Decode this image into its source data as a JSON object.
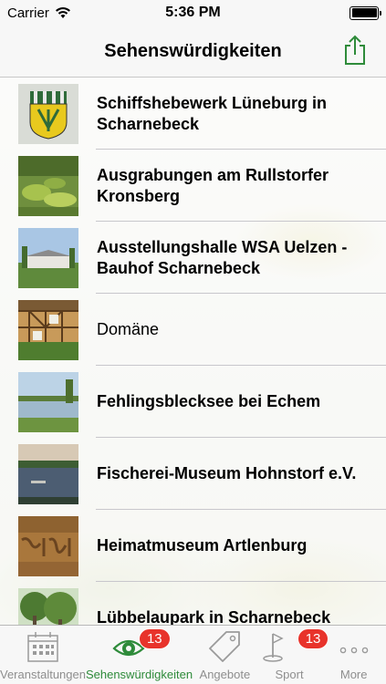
{
  "status": {
    "carrier": "Carrier",
    "time": "5:36 PM",
    "battery_level": 1.0
  },
  "nav": {
    "title": "Sehenswürdigkeiten"
  },
  "items": [
    {
      "label": "Schiffshebewerk  Lüneburg in Scharnebeck",
      "thumb": "coat-of-arms"
    },
    {
      "label": "Ausgrabungen am Rullstorfer Kronsberg",
      "thumb": "garden"
    },
    {
      "label": "Ausstellungshalle WSA Uelzen - Bauhof Scharnebeck",
      "thumb": "hall"
    },
    {
      "label": "Domäne",
      "thumb": "half-timbered-house"
    },
    {
      "label": "Fehlingsblecksee bei Echem",
      "thumb": "lake"
    },
    {
      "label": "Fischerei-Museum Hohnstorf e.V.",
      "thumb": "river"
    },
    {
      "label": "Heimatmuseum Artlenburg",
      "thumb": "inscription"
    },
    {
      "label": "Lübbelaupark in Scharnebeck",
      "thumb": "park"
    }
  ],
  "tabs": [
    {
      "label": "Veranstaltungen",
      "icon": "calendar-icon"
    },
    {
      "label": "Sehenswürdigkeiten",
      "icon": "eye-icon",
      "badge": "13"
    },
    {
      "label": "Angebote",
      "icon": "tag-icon"
    },
    {
      "label": "Sport",
      "icon": "golf-icon",
      "badge": "13"
    },
    {
      "label": "More",
      "icon": "more-icon"
    }
  ],
  "colors": {
    "accent": "#2e8b3a",
    "badge": "#e8332b"
  }
}
